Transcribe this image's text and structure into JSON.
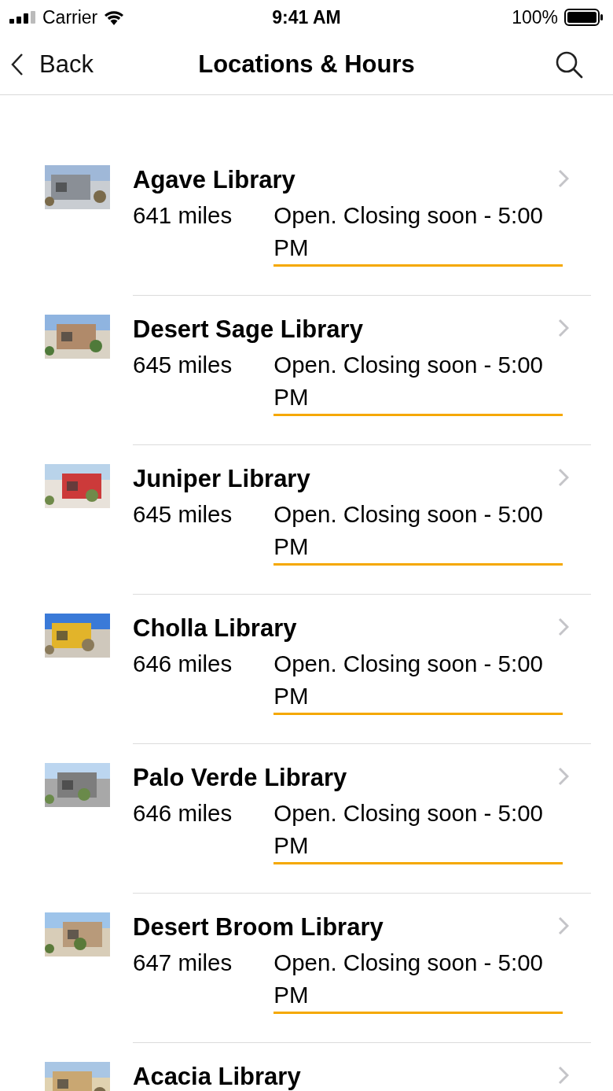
{
  "status_bar": {
    "carrier": "Carrier",
    "time": "9:41 AM",
    "battery": "100%"
  },
  "nav": {
    "back": "Back",
    "title": "Locations & Hours"
  },
  "locations": [
    {
      "name": "Agave Library",
      "distance": "641 miles",
      "status": "Open. Closing soon - 5:00 PM",
      "closing_soon": true
    },
    {
      "name": "Desert Sage Library",
      "distance": "645 miles",
      "status": "Open. Closing soon - 5:00 PM",
      "closing_soon": true
    },
    {
      "name": "Juniper Library",
      "distance": "645 miles",
      "status": "Open. Closing soon - 5:00 PM",
      "closing_soon": true
    },
    {
      "name": "Cholla Library",
      "distance": "646 miles",
      "status": "Open. Closing soon - 5:00 PM",
      "closing_soon": true
    },
    {
      "name": "Palo Verde Library",
      "distance": "646 miles",
      "status": "Open. Closing soon - 5:00 PM",
      "closing_soon": true
    },
    {
      "name": "Desert Broom Library",
      "distance": "647 miles",
      "status": "Open. Closing soon - 5:00 PM",
      "closing_soon": true
    },
    {
      "name": "Acacia Library"
    }
  ]
}
